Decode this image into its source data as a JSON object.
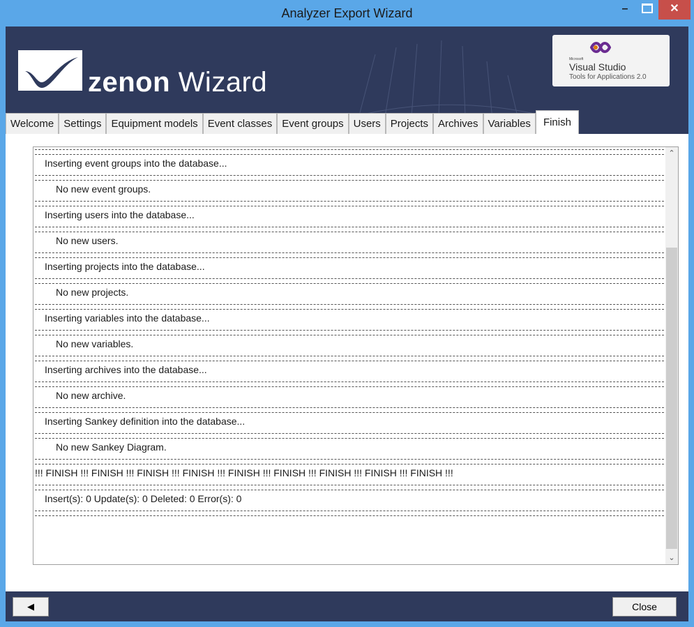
{
  "window": {
    "title": "Analyzer Export Wizard",
    "minimize_label": "–",
    "close_label": "✕"
  },
  "header": {
    "logo_prefix": "zenon",
    "logo_suffix": "Wizard",
    "vs_badge": {
      "brand_small": "Microsoft",
      "title": "Visual Studio",
      "subtitle": "Tools for Applications 2.0"
    }
  },
  "tabs": [
    {
      "label": "Welcome"
    },
    {
      "label": "Settings"
    },
    {
      "label": "Equipment models"
    },
    {
      "label": "Event classes"
    },
    {
      "label": "Event groups"
    },
    {
      "label": "Users"
    },
    {
      "label": "Projects"
    },
    {
      "label": "Archives"
    },
    {
      "label": "Variables"
    },
    {
      "label": "Finish",
      "active": true
    }
  ],
  "log": {
    "lines": [
      {
        "type": "sep"
      },
      {
        "type": "text",
        "text": "Inserting event groups into the database..."
      },
      {
        "type": "sep"
      },
      {
        "type": "text",
        "text": "No new event groups.",
        "indent": true
      },
      {
        "type": "sep"
      },
      {
        "type": "text",
        "text": "Inserting users into the database..."
      },
      {
        "type": "sep"
      },
      {
        "type": "text",
        "text": "No new users.",
        "indent": true
      },
      {
        "type": "sep"
      },
      {
        "type": "text",
        "text": "Inserting projects into the database..."
      },
      {
        "type": "sep"
      },
      {
        "type": "text",
        "text": "No new projects.",
        "indent": true
      },
      {
        "type": "sep"
      },
      {
        "type": "text",
        "text": "Inserting variables into the database..."
      },
      {
        "type": "sep"
      },
      {
        "type": "text",
        "text": "No new variables.",
        "indent": true
      },
      {
        "type": "sep"
      },
      {
        "type": "text",
        "text": "Inserting archives into the database..."
      },
      {
        "type": "sep"
      },
      {
        "type": "text",
        "text": "No new archive.",
        "indent": true
      },
      {
        "type": "sep"
      },
      {
        "type": "text",
        "text": "Inserting Sankey definition into the database..."
      },
      {
        "type": "sep"
      },
      {
        "type": "text",
        "text": "No new Sankey Diagram.",
        "indent": true
      },
      {
        "type": "sep"
      },
      {
        "type": "finish",
        "text": "!!! FINISH !!! FINISH !!! FINISH !!! FINISH !!! FINISH !!! FINISH !!! FINISH !!! FINISH !!! FINISH !!!"
      },
      {
        "type": "sep"
      },
      {
        "type": "text",
        "text": "Insert(s): 0  Update(s): 0  Deleted: 0  Error(s): 0"
      },
      {
        "type": "sep"
      }
    ],
    "scroll_position": 0.72
  },
  "footer": {
    "back_label": "◀",
    "close_label": "Close"
  },
  "colors": {
    "titlebar": "#5aa7e8",
    "banner": "#2f3a5c",
    "close_button": "#c74f4a"
  }
}
